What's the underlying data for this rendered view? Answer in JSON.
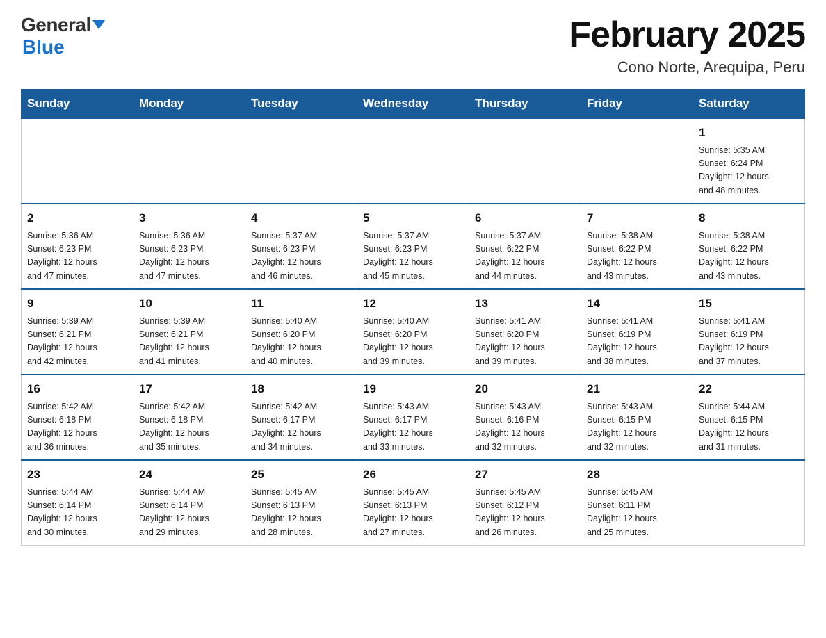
{
  "logo": {
    "top": "General",
    "bottom": "Blue"
  },
  "title": "February 2025",
  "subtitle": "Cono Norte, Arequipa, Peru",
  "weekdays": [
    "Sunday",
    "Monday",
    "Tuesday",
    "Wednesday",
    "Thursday",
    "Friday",
    "Saturday"
  ],
  "weeks": [
    [
      {
        "day": "",
        "info": ""
      },
      {
        "day": "",
        "info": ""
      },
      {
        "day": "",
        "info": ""
      },
      {
        "day": "",
        "info": ""
      },
      {
        "day": "",
        "info": ""
      },
      {
        "day": "",
        "info": ""
      },
      {
        "day": "1",
        "info": "Sunrise: 5:35 AM\nSunset: 6:24 PM\nDaylight: 12 hours\nand 48 minutes."
      }
    ],
    [
      {
        "day": "2",
        "info": "Sunrise: 5:36 AM\nSunset: 6:23 PM\nDaylight: 12 hours\nand 47 minutes."
      },
      {
        "day": "3",
        "info": "Sunrise: 5:36 AM\nSunset: 6:23 PM\nDaylight: 12 hours\nand 47 minutes."
      },
      {
        "day": "4",
        "info": "Sunrise: 5:37 AM\nSunset: 6:23 PM\nDaylight: 12 hours\nand 46 minutes."
      },
      {
        "day": "5",
        "info": "Sunrise: 5:37 AM\nSunset: 6:23 PM\nDaylight: 12 hours\nand 45 minutes."
      },
      {
        "day": "6",
        "info": "Sunrise: 5:37 AM\nSunset: 6:22 PM\nDaylight: 12 hours\nand 44 minutes."
      },
      {
        "day": "7",
        "info": "Sunrise: 5:38 AM\nSunset: 6:22 PM\nDaylight: 12 hours\nand 43 minutes."
      },
      {
        "day": "8",
        "info": "Sunrise: 5:38 AM\nSunset: 6:22 PM\nDaylight: 12 hours\nand 43 minutes."
      }
    ],
    [
      {
        "day": "9",
        "info": "Sunrise: 5:39 AM\nSunset: 6:21 PM\nDaylight: 12 hours\nand 42 minutes."
      },
      {
        "day": "10",
        "info": "Sunrise: 5:39 AM\nSunset: 6:21 PM\nDaylight: 12 hours\nand 41 minutes."
      },
      {
        "day": "11",
        "info": "Sunrise: 5:40 AM\nSunset: 6:20 PM\nDaylight: 12 hours\nand 40 minutes."
      },
      {
        "day": "12",
        "info": "Sunrise: 5:40 AM\nSunset: 6:20 PM\nDaylight: 12 hours\nand 39 minutes."
      },
      {
        "day": "13",
        "info": "Sunrise: 5:41 AM\nSunset: 6:20 PM\nDaylight: 12 hours\nand 39 minutes."
      },
      {
        "day": "14",
        "info": "Sunrise: 5:41 AM\nSunset: 6:19 PM\nDaylight: 12 hours\nand 38 minutes."
      },
      {
        "day": "15",
        "info": "Sunrise: 5:41 AM\nSunset: 6:19 PM\nDaylight: 12 hours\nand 37 minutes."
      }
    ],
    [
      {
        "day": "16",
        "info": "Sunrise: 5:42 AM\nSunset: 6:18 PM\nDaylight: 12 hours\nand 36 minutes."
      },
      {
        "day": "17",
        "info": "Sunrise: 5:42 AM\nSunset: 6:18 PM\nDaylight: 12 hours\nand 35 minutes."
      },
      {
        "day": "18",
        "info": "Sunrise: 5:42 AM\nSunset: 6:17 PM\nDaylight: 12 hours\nand 34 minutes."
      },
      {
        "day": "19",
        "info": "Sunrise: 5:43 AM\nSunset: 6:17 PM\nDaylight: 12 hours\nand 33 minutes."
      },
      {
        "day": "20",
        "info": "Sunrise: 5:43 AM\nSunset: 6:16 PM\nDaylight: 12 hours\nand 32 minutes."
      },
      {
        "day": "21",
        "info": "Sunrise: 5:43 AM\nSunset: 6:15 PM\nDaylight: 12 hours\nand 32 minutes."
      },
      {
        "day": "22",
        "info": "Sunrise: 5:44 AM\nSunset: 6:15 PM\nDaylight: 12 hours\nand 31 minutes."
      }
    ],
    [
      {
        "day": "23",
        "info": "Sunrise: 5:44 AM\nSunset: 6:14 PM\nDaylight: 12 hours\nand 30 minutes."
      },
      {
        "day": "24",
        "info": "Sunrise: 5:44 AM\nSunset: 6:14 PM\nDaylight: 12 hours\nand 29 minutes."
      },
      {
        "day": "25",
        "info": "Sunrise: 5:45 AM\nSunset: 6:13 PM\nDaylight: 12 hours\nand 28 minutes."
      },
      {
        "day": "26",
        "info": "Sunrise: 5:45 AM\nSunset: 6:13 PM\nDaylight: 12 hours\nand 27 minutes."
      },
      {
        "day": "27",
        "info": "Sunrise: 5:45 AM\nSunset: 6:12 PM\nDaylight: 12 hours\nand 26 minutes."
      },
      {
        "day": "28",
        "info": "Sunrise: 5:45 AM\nSunset: 6:11 PM\nDaylight: 12 hours\nand 25 minutes."
      },
      {
        "day": "",
        "info": ""
      }
    ]
  ]
}
